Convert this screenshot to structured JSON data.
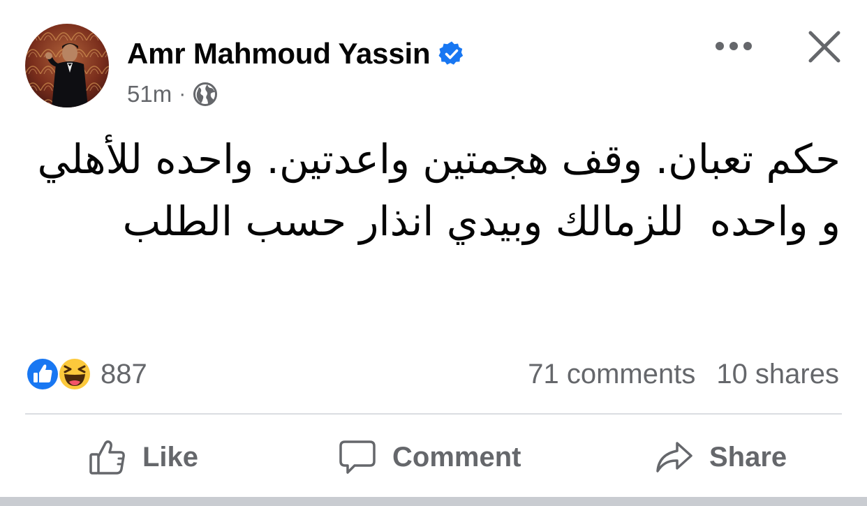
{
  "post": {
    "author_name": "Amr Mahmoud Yassin",
    "timestamp": "51m",
    "separator": "·",
    "audience_icon": "globe-icon",
    "verified_icon": "verified-badge-icon",
    "text": "حكم تعبان. وقف هجمتين واعدتين. واحده للأهلي  و واحده  للزمالك وبيدي انذار حسب الطلب"
  },
  "header_actions": {
    "more_icon": "more-options-icon",
    "close_icon": "close-icon"
  },
  "reactions": {
    "icons": [
      "like-reaction-icon",
      "haha-reaction-icon"
    ],
    "count": "887"
  },
  "engagement": {
    "comments": "71 comments",
    "shares": "10 shares"
  },
  "actions": {
    "like_label": "Like",
    "comment_label": "Comment",
    "share_label": "Share"
  },
  "colors": {
    "text_primary": "#050505",
    "text_secondary": "#65676b",
    "verified_blue": "#1877f2",
    "divider": "#dadde1",
    "haha_yellow": "#fcc93c"
  }
}
